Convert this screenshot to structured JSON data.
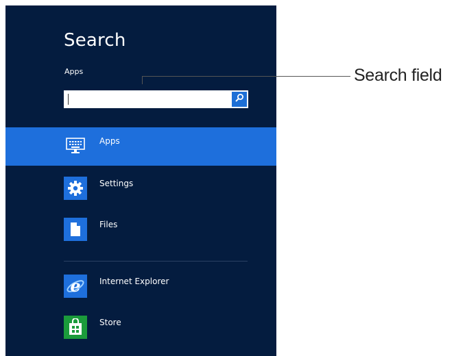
{
  "search_panel": {
    "title": "Search",
    "scope_label": "Apps",
    "search_input_value": "",
    "search_button_icon": "search-icon",
    "categories": [
      {
        "label": "Apps",
        "icon": "keyboard-icon",
        "selected": true
      },
      {
        "label": "Settings",
        "icon": "gear-icon",
        "selected": false
      },
      {
        "label": "Files",
        "icon": "file-icon",
        "selected": false
      }
    ],
    "pinned_apps": [
      {
        "label": "Internet Explorer",
        "icon": "internet-explorer-icon"
      },
      {
        "label": "Store",
        "icon": "store-icon"
      }
    ]
  },
  "annotation": {
    "label": "Search field"
  },
  "colors": {
    "panel_background": "#041c3f",
    "selection_blue": "#1e6fdc",
    "store_green": "#1b9b3b"
  }
}
